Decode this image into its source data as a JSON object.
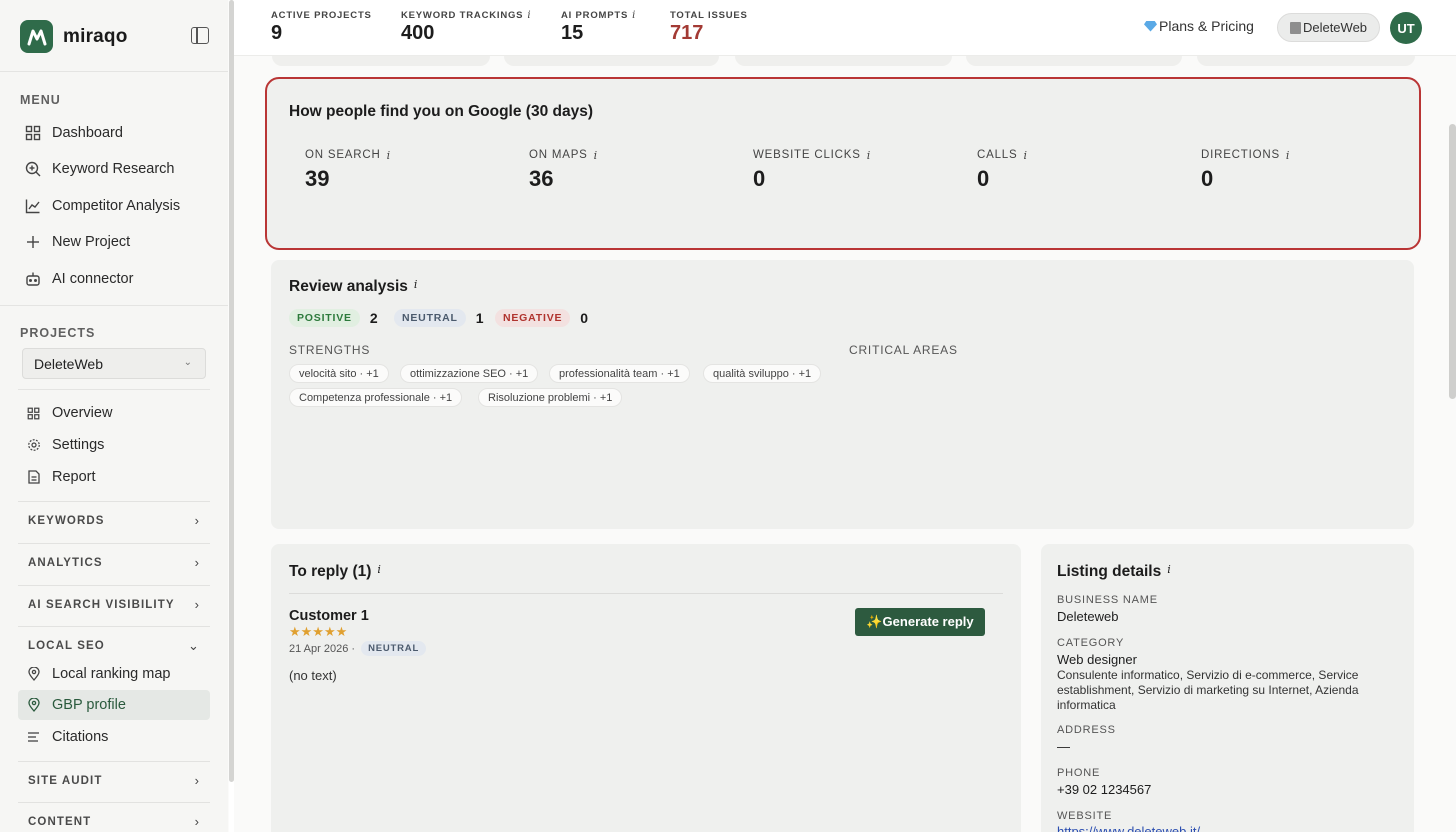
{
  "brand": {
    "name": "miraqo",
    "logo_icon": "miraqo-logo-icon",
    "accent": "#2f6b4a"
  },
  "sidebar": {
    "menu_label": "MENU",
    "menu_items": [
      {
        "label": "Dashboard",
        "icon": "grid-icon"
      },
      {
        "label": "Keyword Research",
        "icon": "search-plus-icon"
      },
      {
        "label": "Competitor Analysis",
        "icon": "line-chart-icon"
      },
      {
        "label": "New Project",
        "icon": "plus-icon"
      },
      {
        "label": "AI connector",
        "icon": "robot-icon"
      }
    ],
    "projects_label": "PROJECTS",
    "project_selected": "DeleteWeb",
    "project_items": [
      {
        "label": "Overview",
        "icon": "grid-icon"
      },
      {
        "label": "Settings",
        "icon": "gear-icon"
      },
      {
        "label": "Report",
        "icon": "document-icon"
      }
    ],
    "groups": {
      "keywords": "KEYWORDS",
      "analytics": "ANALYTICS",
      "ai_visibility": "AI SEARCH VISIBILITY",
      "local_seo": "LOCAL SEO",
      "site_audit": "SITE AUDIT",
      "content": "CONTENT"
    },
    "local_seo_items": [
      {
        "label": "Local ranking map",
        "icon": "pin-icon"
      },
      {
        "label": "GBP profile",
        "icon": "pin-icon",
        "active": true
      },
      {
        "label": "Citations",
        "icon": "list-icon"
      }
    ]
  },
  "topbar": {
    "stats": [
      {
        "label": "ACTIVE PROJECTS",
        "value": "9"
      },
      {
        "label": "KEYWORD TRACKINGS",
        "value": "400",
        "info": "i"
      },
      {
        "label": "AI PROMPTS",
        "value": "15",
        "info": "i"
      },
      {
        "label": "TOTAL ISSUES",
        "value": "717",
        "color": "#a33a34"
      }
    ],
    "plans_label": "Plans & Pricing",
    "project_pill": "DeleteWeb",
    "avatar_initials": "UT"
  },
  "google_card": {
    "title": "How people find you on Google (30 days)",
    "metrics": [
      {
        "label": "ON SEARCH",
        "value": "39",
        "info": "i"
      },
      {
        "label": "ON MAPS",
        "value": "36",
        "info": "i"
      },
      {
        "label": "WEBSITE CLICKS",
        "value": "0",
        "info": "i"
      },
      {
        "label": "CALLS",
        "value": "0",
        "info": "i"
      },
      {
        "label": "DIRECTIONS",
        "value": "0",
        "info": "i"
      }
    ]
  },
  "reviews": {
    "title": "Review analysis",
    "info": "i",
    "positive_label": "POSITIVE",
    "positive_count": "2",
    "neutral_label": "NEUTRAL",
    "neutral_count": "1",
    "negative_label": "NEGATIVE",
    "negative_count": "0",
    "strengths_label": "STRENGTHS",
    "critical_label": "CRITICAL AREAS",
    "strengths": [
      "velocità sito · +1",
      "ottimizzazione SEO · +1",
      "professionalità team · +1",
      "qualità sviluppo · +1",
      "Competenza professionale · +1",
      "Risoluzione problemi · +1"
    ]
  },
  "to_reply": {
    "title": "To reply (1)",
    "info": "i",
    "customer": "Customer 1",
    "stars": "★★★★★",
    "date": "21 Apr 2026 ·",
    "sentiment": "NEUTRAL",
    "text": "(no text)",
    "button_label": "✨Generate reply"
  },
  "listing": {
    "title": "Listing details",
    "info": "i",
    "business_name_label": "BUSINESS NAME",
    "business_name": "Deleteweb",
    "category_label": "CATEGORY",
    "category": "Web designer",
    "category_extra": "Consulente informatico, Servizio di e-commerce, Service establishment, Servizio di marketing su Internet, Azienda informatica",
    "address_label": "ADDRESS",
    "address": "—",
    "phone_label": "PHONE",
    "phone": "+39 02 1234567",
    "website_label": "WEBSITE",
    "website": "https://www.deleteweb.it/"
  },
  "colors": {
    "highlight_border": "#b93535",
    "button_bg": "#2d5a3f"
  }
}
